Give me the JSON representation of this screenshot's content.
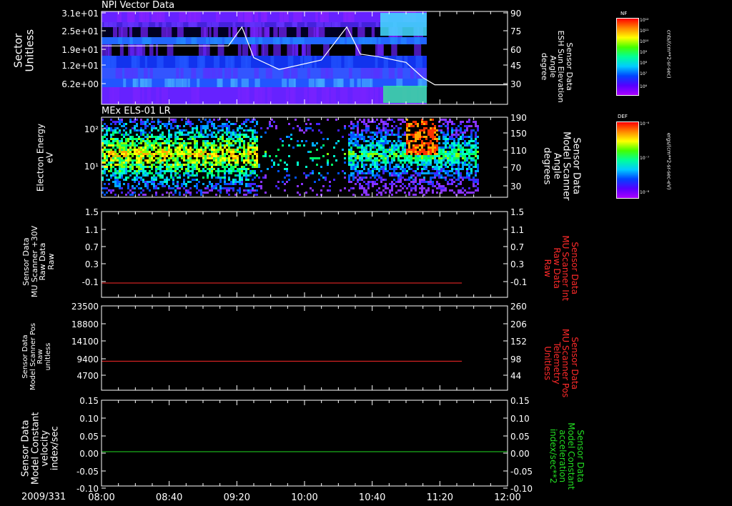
{
  "colors": {
    "bg": "#000000",
    "axis": "#ffffff",
    "red": "#ff2a2a",
    "green": "#22dd22",
    "white": "#ffffff"
  },
  "panels": [
    {
      "title": "NPI Vector Data",
      "left_label_lines": [
        "Sector",
        "Unitless"
      ],
      "right_label_lines": [
        "Sensor Data",
        "ESH Sun Elevation",
        "Angle",
        "degree"
      ],
      "left_ticks": [
        "3.1e+01",
        "2.5e+01",
        "1.9e+01",
        "1.2e+01",
        "6.2e+00"
      ],
      "right_ticks": [
        "90",
        "75",
        "60",
        "45",
        "30"
      ],
      "right_color": "white"
    },
    {
      "title": "MEx ELS-01 LR",
      "left_label_lines": [
        "Electron Energy",
        "eV"
      ],
      "right_label_lines": [
        "Sensor Data",
        "Model Scanner",
        "Angle",
        "degrees"
      ],
      "left_ticks": [
        "10²",
        "10¹"
      ],
      "right_ticks": [
        "190",
        "150",
        "110",
        "70",
        "30"
      ],
      "right_color": "white"
    },
    {
      "title": "",
      "left_label_lines": [
        "Sensor Data",
        "MU Scanner +30V",
        "Raw Data",
        "Raw"
      ],
      "right_label_lines": [
        "Sensor Data",
        "MU Scanner Int",
        "Raw Data",
        "Raw"
      ],
      "left_ticks": [
        "1.5",
        "1.1",
        "0.7",
        "0.3",
        "-0.1"
      ],
      "right_ticks": [
        "1.5",
        "1.1",
        "0.7",
        "0.3",
        "-0.1"
      ],
      "right_color": "red"
    },
    {
      "title": "",
      "left_label_lines": [
        "Sensor Data",
        "Model Scanner Pos",
        "Raw",
        "unitless"
      ],
      "right_label_lines": [
        "Sensor Data",
        "MU Scanner Pos",
        "Telemetry",
        "Unitless"
      ],
      "left_ticks": [
        "23500",
        "18800",
        "14100",
        "9400",
        "4700"
      ],
      "right_ticks": [
        "260",
        "206",
        "152",
        "98",
        "44"
      ],
      "right_color": "red"
    },
    {
      "title": "",
      "left_label_lines": [
        "Sensor Data",
        "Model Constant",
        "velocity",
        "index/sec"
      ],
      "right_label_lines": [
        "Sensor Data",
        "Model Constant",
        "acceleration",
        "index/sec**2"
      ],
      "left_ticks": [
        "0.15",
        "0.10",
        "0.05",
        "0.00",
        "-0.05",
        "-0.10"
      ],
      "right_ticks": [
        "0.15",
        "0.10",
        "0.05",
        "0.00",
        "-0.05",
        "-0.10"
      ],
      "right_color": "green"
    }
  ],
  "time_axis": {
    "date": "2009/331",
    "ticks": [
      "08:00",
      "08:40",
      "09:20",
      "10:00",
      "10:40",
      "11:20",
      "12:00"
    ]
  },
  "colorbars": [
    {
      "tag": "NF",
      "unit": "cnts/(cm**2-sr-sec)",
      "labels": [
        "10¹²",
        "10¹¹",
        "10¹⁰",
        "10⁹",
        "10⁸",
        "10⁷",
        "10⁶"
      ]
    },
    {
      "tag": "DEF",
      "unit": "ergs/(cm**2-sr-sec-eV)",
      "labels": [
        "10⁻⁶",
        "10⁻⁷",
        "10⁻⁸"
      ]
    }
  ],
  "chart_data": [
    {
      "type": "heatmap",
      "title": "NPI Vector Data",
      "ylabel": "Sector Unitless",
      "yticks": [
        "3.1e+01",
        "2.5e+01",
        "1.9e+01",
        "1.2e+01",
        "6.2e+00"
      ],
      "overlay_line": {
        "name": "ESH Sun Elevation Angle",
        "unit": "degree",
        "x": [
          "08:00",
          "09:15",
          "09:23",
          "09:30",
          "09:45",
          "10:10",
          "10:25",
          "10:33",
          "10:43",
          "11:00",
          "11:10",
          "11:17",
          "12:00"
        ],
        "y": [
          62,
          62,
          78,
          52,
          42,
          50,
          78,
          55,
          53,
          48,
          35,
          29,
          29
        ]
      }
    },
    {
      "type": "heatmap",
      "title": "MEx ELS-01 LR",
      "ylabel": "Electron Energy eV",
      "yticks": [
        "10²",
        "10¹"
      ],
      "overlay_line": {
        "name": "Model Scanner Angle",
        "unit": "degrees",
        "x": [
          "08:00",
          "11:33"
        ],
        "y": [
          10,
          10
        ]
      }
    },
    {
      "type": "line",
      "ylabel": "MU Scanner +30V Raw Data",
      "ylim": [
        -0.3,
        1.5
      ],
      "series": [
        {
          "name": "MU Scanner Int Raw Data",
          "x": [
            "08:00",
            "11:33"
          ],
          "y": [
            0,
            0
          ]
        }
      ]
    },
    {
      "type": "line",
      "ylabel": "Model Scanner Pos Raw",
      "ylim": [
        0,
        23500
      ],
      "series": [
        {
          "name": "MU Scanner Pos Telemetry",
          "x": [
            "08:00",
            "11:33"
          ],
          "y": [
            8100,
            8100
          ]
        }
      ]
    },
    {
      "type": "line",
      "ylabel": "Model Constant velocity index/sec",
      "ylim": [
        -0.1,
        0.15
      ],
      "series": [
        {
          "name": "Model Constant acceleration index/sec**2",
          "x": [
            "08:00",
            "12:00"
          ],
          "y": [
            0,
            0
          ]
        }
      ]
    }
  ]
}
